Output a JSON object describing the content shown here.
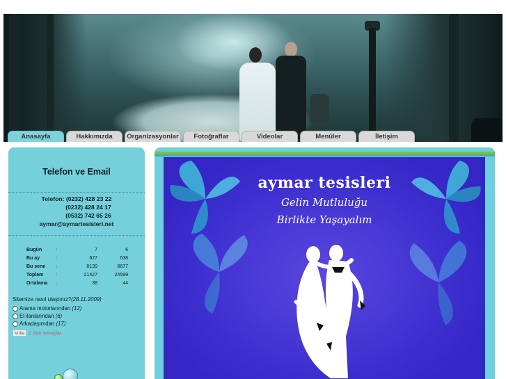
{
  "nav": {
    "tabs": [
      {
        "label": "Anasayfa",
        "active": true
      },
      {
        "label": "Hakkımızda",
        "active": false
      },
      {
        "label": "Organizasyonlar",
        "active": false
      },
      {
        "label": "Fotoğraflar",
        "active": false
      },
      {
        "label": "Videolar",
        "active": false
      },
      {
        "label": "Menüler",
        "active": false
      },
      {
        "label": "İletişim",
        "active": false
      }
    ]
  },
  "sidebar": {
    "title": "Telefon ve Email",
    "contact": {
      "phone1": "Telefon: (0232) 428 23 22",
      "phone2": "(0232) 428 24 17",
      "phone3": "(0532) 742 65 26",
      "email": "aymar@aymartesisleri.net"
    },
    "stats": [
      {
        "label": "Bugün",
        "sep": ":",
        "a": "7",
        "b": "6"
      },
      {
        "label": "Bu ay",
        "sep": ":",
        "a": "627",
        "b": "638"
      },
      {
        "label": "Bu sene",
        "sep": ":",
        "a": "8139",
        "b": "8677"
      },
      {
        "label": "Toplam",
        "sep": ":",
        "a": "21427",
        "b": "24599"
      },
      {
        "label": "Ortalama",
        "sep": ":",
        "a": "38",
        "b": "44"
      }
    ],
    "poll": {
      "question": "Sitemize nasıl ulaştınız?",
      "date": "(28.11.2009)",
      "options": [
        {
          "label": "Arama motorlarından",
          "count": "(12)"
        },
        {
          "label": "El ilanlarından",
          "count": "(6)"
        },
        {
          "label": "Arkadaşımdan",
          "count": "(17)"
        }
      ],
      "vote_label": "Volla",
      "separator": "::",
      "results_label": "tüm sonuçlar"
    }
  },
  "banner": {
    "title": "aymar tesisleri",
    "line1": "Gelin Mutluluğu",
    "line2": "Birlikte Yaşayalım"
  },
  "colors": {
    "sidebar_bg": "#74d0db",
    "banner_bg": "#3d2fcf",
    "tab_active": "#7dd3dc",
    "tab_inactive": "#d9d9d9",
    "stripe_green": "#7dc040"
  }
}
